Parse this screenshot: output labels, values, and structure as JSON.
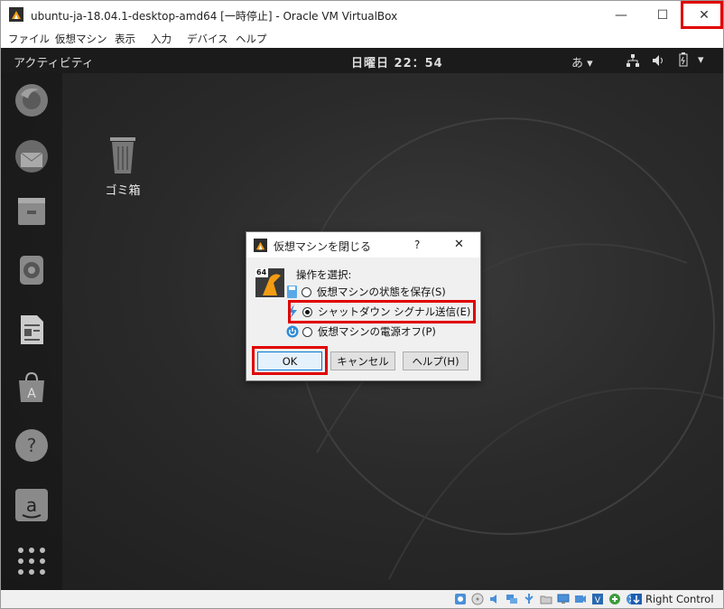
{
  "window": {
    "title": "ubuntu-ja-18.04.1-desktop-amd64 [一時停止] - Oracle VM VirtualBox",
    "minimize_label": "—",
    "maximize_label": "☐",
    "close_label": "✕"
  },
  "menu": [
    "ファイル",
    "仮想マシン",
    "表示",
    "入力",
    "デバイス",
    "ヘルプ"
  ],
  "guest": {
    "activities": "アクティビティ",
    "clock": "日曜日 22：54",
    "ime": "あ ▾",
    "trash_label": "ゴミ箱"
  },
  "dialog": {
    "title": "仮想マシンを閉じる",
    "help_glyph": "?",
    "close_glyph": "✕",
    "prompt": "操作を選択:",
    "options": [
      {
        "label": "仮想マシンの状態を保存(S)",
        "selected": false
      },
      {
        "label": "シャットダウン シグナル送信(E)",
        "selected": true
      },
      {
        "label": "仮想マシンの電源オフ(P)",
        "selected": false
      }
    ],
    "buttons": {
      "ok": "OK",
      "cancel": "キャンセル",
      "help": "ヘルプ(H)"
    },
    "badge": "64"
  },
  "statusbar": {
    "host_key": "Right Control"
  },
  "colors": {
    "highlight": "#e00000",
    "guest_bg": "#2b2b2b",
    "topbar": "#1b1b1b"
  }
}
